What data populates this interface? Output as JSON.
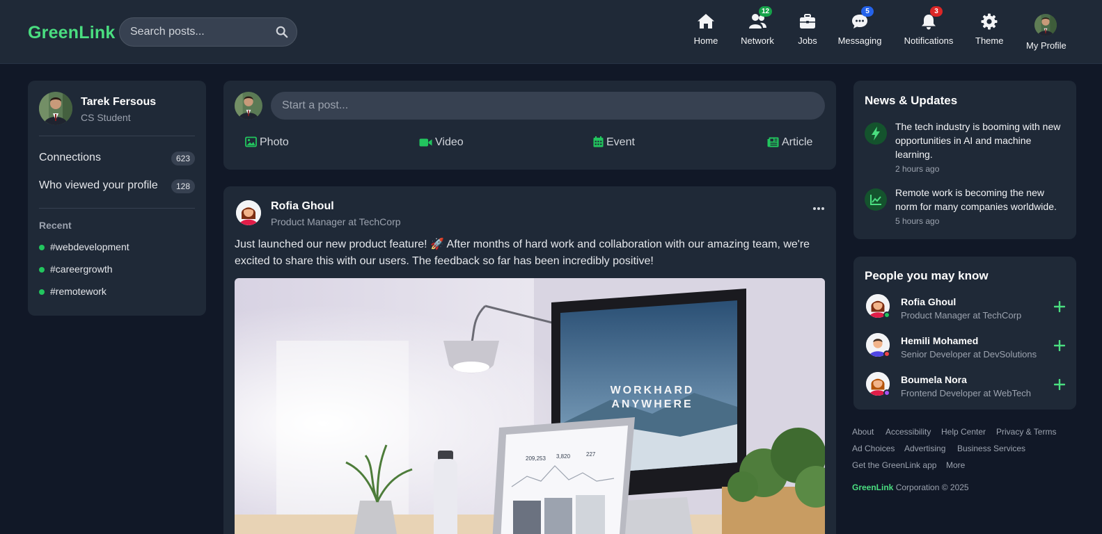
{
  "app": {
    "name": "GreenLink"
  },
  "search": {
    "placeholder": "Search posts..."
  },
  "nav": [
    {
      "label": "Home",
      "icon": "home-icon"
    },
    {
      "label": "Network",
      "icon": "users-icon",
      "badge": "12",
      "badge_color": "#16a34a"
    },
    {
      "label": "Jobs",
      "icon": "briefcase-icon"
    },
    {
      "label": "Messaging",
      "icon": "chat-icon",
      "badge": "5",
      "badge_color": "#2563eb"
    },
    {
      "label": "Notifications",
      "icon": "bell-icon",
      "badge": "3",
      "badge_color": "#dc2626"
    },
    {
      "label": "Theme",
      "icon": "gear-icon"
    },
    {
      "label": "My Profile",
      "icon": "avatar"
    }
  ],
  "profile": {
    "name": "Tarek Fersous",
    "role": "CS Student",
    "stats": [
      {
        "label": "Connections",
        "count": "623"
      },
      {
        "label": "Who viewed your profile",
        "count": "128"
      }
    ],
    "recent_label": "Recent",
    "recent": [
      "#webdevelopment",
      "#careergrowth",
      "#remotework"
    ]
  },
  "composer": {
    "placeholder": "Start a post...",
    "actions": [
      {
        "label": "Photo",
        "icon": "image-icon"
      },
      {
        "label": "Video",
        "icon": "video-icon"
      },
      {
        "label": "Event",
        "icon": "calendar-icon"
      },
      {
        "label": "Article",
        "icon": "newspaper-icon"
      }
    ]
  },
  "post": {
    "author": "Rofia Ghoul",
    "role": "Product Manager at TechCorp",
    "text": "Just launched our new product feature! 🚀 After months of hard work and collaboration with our amazing team, we're excited to share this with our users. The feedback so far has been incredibly positive!",
    "image": {
      "monitor_line1": "WORKHARD",
      "monitor_line2": "ANYWHERE",
      "laptop_stats": [
        "209,253",
        "3,820",
        "227"
      ]
    }
  },
  "news": {
    "title": "News & Updates",
    "items": [
      {
        "text": "The tech industry is booming with new opportunities in AI and machine learning.",
        "time": "2 hours ago",
        "icon": "lightning-icon"
      },
      {
        "text": "Remote work is becoming the new norm for many companies worldwide.",
        "time": "5 hours ago",
        "icon": "chart-line-icon"
      }
    ]
  },
  "people": {
    "title": "People you may know",
    "items": [
      {
        "name": "Rofia Ghoul",
        "role": "Product Manager at TechCorp",
        "status_color": "#22c55e"
      },
      {
        "name": "Hemili Mohamed",
        "role": "Senior Developer at DevSolutions",
        "status_color": "#ef4444"
      },
      {
        "name": "Boumela Nora",
        "role": "Frontend Developer at WebTech",
        "status_color": "#a855f7"
      }
    ]
  },
  "footer": {
    "links": [
      "About",
      "Accessibility",
      "Help Center",
      "Privacy & Terms",
      "Ad Choices",
      "Advertising",
      "Business Services",
      "Get the GreenLink app",
      "More"
    ],
    "brand": "GreenLink",
    "copyright": "Corporation © 2025"
  },
  "colors": {
    "accent": "#4ade80",
    "background": "#111827",
    "card": "#1f2937"
  }
}
